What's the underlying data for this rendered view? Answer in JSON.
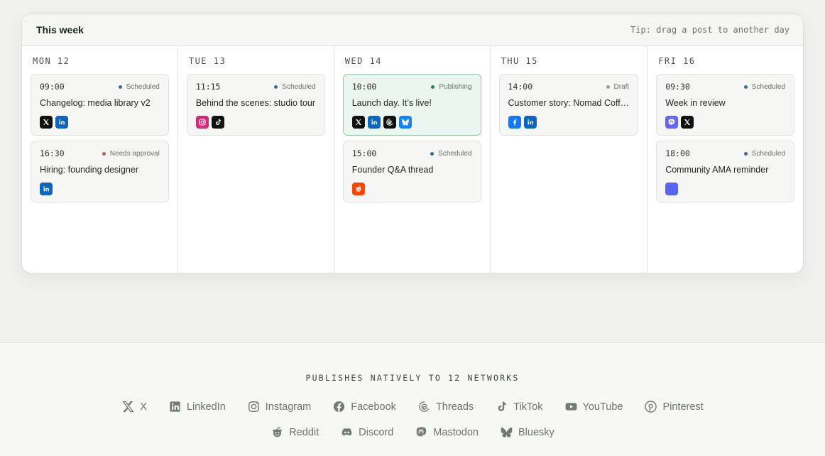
{
  "calendar": {
    "title": "This week",
    "tip": "Tip: drag a post to another day",
    "days": [
      {
        "label": "MON 12",
        "posts": [
          {
            "time": "09:00",
            "status": "Scheduled",
            "title": "Changelog: media library v2",
            "networks": [
              "x",
              "linkedin"
            ]
          },
          {
            "time": "16:30",
            "status": "Needs approval",
            "title": "Hiring: founding designer",
            "networks": [
              "linkedin"
            ]
          }
        ]
      },
      {
        "label": "TUE 13",
        "posts": [
          {
            "time": "11:15",
            "status": "Scheduled",
            "title": "Behind the scenes: studio tour",
            "networks": [
              "instagram",
              "tiktok"
            ]
          }
        ]
      },
      {
        "label": "WED 14",
        "posts": [
          {
            "time": "10:00",
            "status": "Publishing",
            "title": "Launch day. It’s live!",
            "networks": [
              "x",
              "linkedin",
              "threads",
              "bluesky"
            ]
          },
          {
            "time": "15:00",
            "status": "Scheduled",
            "title": "Founder Q&A thread",
            "networks": [
              "reddit"
            ]
          }
        ]
      },
      {
        "label": "THU 15",
        "posts": [
          {
            "time": "14:00",
            "status": "Draft",
            "title": "Customer story: Nomad Coff…",
            "networks": [
              "facebook",
              "linkedin"
            ]
          }
        ]
      },
      {
        "label": "FRI 16",
        "posts": [
          {
            "time": "09:30",
            "status": "Scheduled",
            "title": "Week in review",
            "networks": [
              "mastodon",
              "x"
            ]
          },
          {
            "time": "18:00",
            "status": "Scheduled",
            "title": "Community AMA reminder",
            "networks": [
              "discord"
            ]
          }
        ]
      }
    ]
  },
  "status_colors": {
    "Scheduled": "#3f6e8a",
    "Needs approval": "#c0614a",
    "Publishing": "#2f7a4f",
    "Draft": "#9a9d9b"
  },
  "network_colors": {
    "x": "#111111",
    "linkedin": "#0a66c2",
    "instagram": "#d62976",
    "tiktok": "#111111",
    "threads": "#111111",
    "bluesky": "#1185fe",
    "reddit": "#ff4500",
    "facebook": "#1877f2",
    "mastodon": "#6364ff",
    "discord": "#5865f2"
  },
  "footer": {
    "title": "PUBLISHES NATIVELY TO 12 NETWORKS",
    "rows": [
      [
        {
          "icon": "x",
          "label": "X"
        },
        {
          "icon": "linkedin",
          "label": "LinkedIn"
        },
        {
          "icon": "instagram",
          "label": "Instagram"
        },
        {
          "icon": "facebook",
          "label": "Facebook"
        },
        {
          "icon": "threads",
          "label": "Threads"
        },
        {
          "icon": "tiktok",
          "label": "TikTok"
        },
        {
          "icon": "youtube",
          "label": "YouTube"
        },
        {
          "icon": "pinterest",
          "label": "Pinterest"
        }
      ],
      [
        {
          "icon": "reddit",
          "label": "Reddit"
        },
        {
          "icon": "discord",
          "label": "Discord"
        },
        {
          "icon": "mastodon",
          "label": "Mastodon"
        },
        {
          "icon": "bluesky",
          "label": "Bluesky"
        }
      ]
    ]
  }
}
